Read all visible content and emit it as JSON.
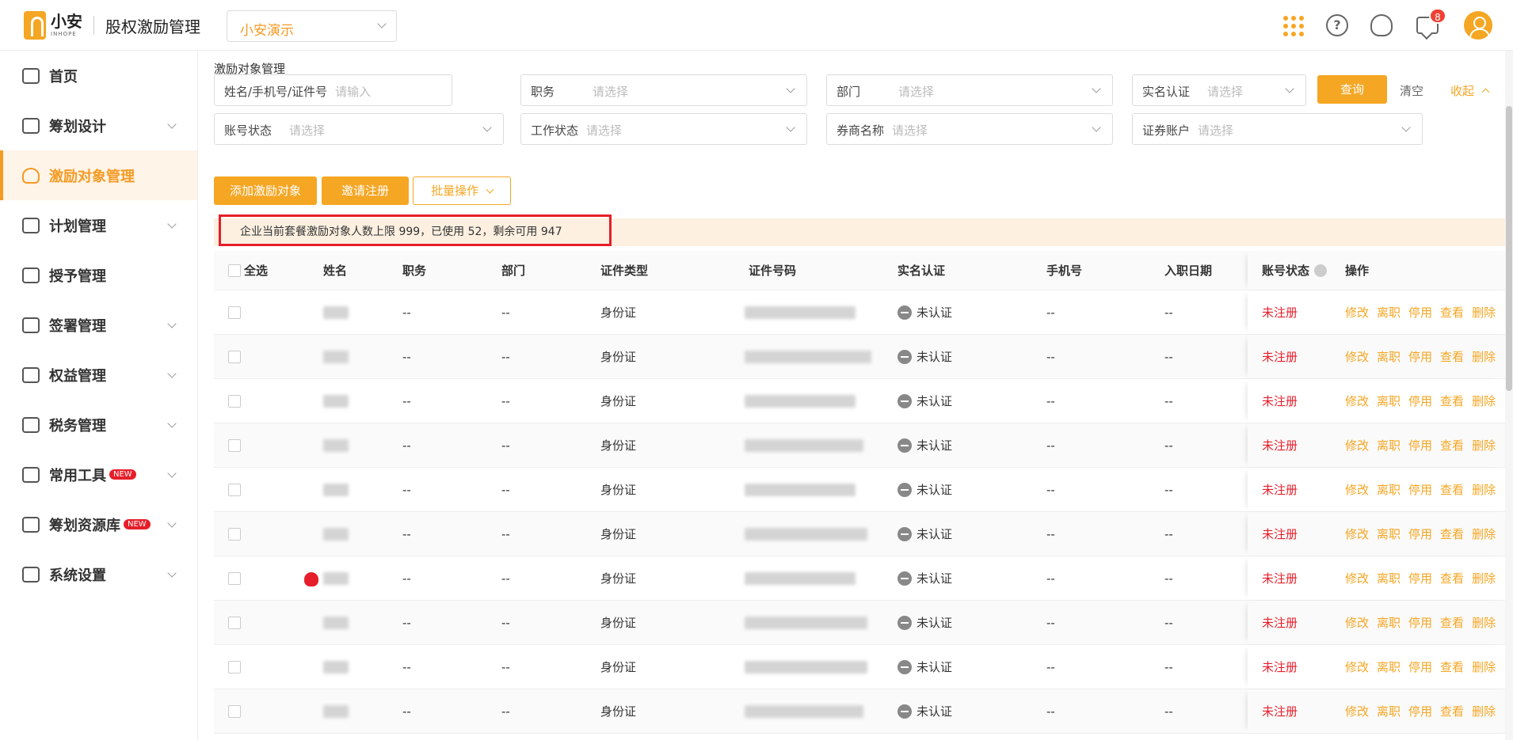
{
  "header": {
    "logo_text": "小安",
    "logo_sub": "INHOPE",
    "app_title": "股权激励管理",
    "company": "小安演示",
    "message_count": "8"
  },
  "sidebar": {
    "items": [
      {
        "label": "首页",
        "icon": "home-icon",
        "chevron": false,
        "new": false
      },
      {
        "label": "筹划设计",
        "icon": "edit-icon",
        "chevron": true,
        "new": false
      },
      {
        "label": "激励对象管理",
        "icon": "users-icon",
        "chevron": false,
        "new": false,
        "active": true
      },
      {
        "label": "计划管理",
        "icon": "grid-plan-icon",
        "chevron": true,
        "new": false
      },
      {
        "label": "授予管理",
        "icon": "book-icon",
        "chevron": false,
        "new": false
      },
      {
        "label": "签署管理",
        "icon": "sign-icon",
        "chevron": true,
        "new": false
      },
      {
        "label": "权益管理",
        "icon": "equity-icon",
        "chevron": true,
        "new": false
      },
      {
        "label": "税务管理",
        "icon": "tax-icon",
        "chevron": true,
        "new": false
      },
      {
        "label": "常用工具",
        "icon": "toolbox-icon",
        "chevron": true,
        "new": true
      },
      {
        "label": "筹划资源库",
        "icon": "layers-icon",
        "chevron": true,
        "new": true
      },
      {
        "label": "系统设置",
        "icon": "settings-icon",
        "chevron": true,
        "new": false
      }
    ],
    "new_label": "NEW"
  },
  "page": {
    "title": "激励对象管理"
  },
  "filters": {
    "name_label": "姓名/手机号/证件号",
    "name_placeholder": "请输入",
    "position_label": "职务",
    "dept_label": "部门",
    "realname_label": "实名认证",
    "account_status_label": "账号状态",
    "work_status_label": "工作状态",
    "broker_label": "券商名称",
    "securities_label": "证券账户",
    "select_placeholder": "请选择",
    "query_btn": "查询",
    "clear_btn": "清空",
    "collapse_link": "收起"
  },
  "actions": {
    "add": "添加激励对象",
    "invite": "邀请注册",
    "batch": "批量操作"
  },
  "notice": "企业当前套餐激励对象人数上限 999，已使用 52，剩余可用 947",
  "table": {
    "headers": {
      "select_all": "全选",
      "name": "姓名",
      "position": "职务",
      "dept": "部门",
      "id_type": "证件类型",
      "id_number": "证件号码",
      "realname": "实名认证",
      "phone": "手机号",
      "join_date": "入职日期",
      "account_status": "账号状态",
      "ops": "操作"
    },
    "rows": [
      {
        "position": "--",
        "dept": "--",
        "id_type": "身份证",
        "realname": "未认证",
        "phone": "--",
        "join_date": "--",
        "status": "未注册",
        "warn": false
      },
      {
        "position": "--",
        "dept": "--",
        "id_type": "身份证",
        "realname": "未认证",
        "phone": "--",
        "join_date": "--",
        "status": "未注册",
        "warn": false
      },
      {
        "position": "--",
        "dept": "--",
        "id_type": "身份证",
        "realname": "未认证",
        "phone": "--",
        "join_date": "--",
        "status": "未注册",
        "warn": false
      },
      {
        "position": "--",
        "dept": "--",
        "id_type": "身份证",
        "realname": "未认证",
        "phone": "--",
        "join_date": "--",
        "status": "未注册",
        "warn": false
      },
      {
        "position": "--",
        "dept": "--",
        "id_type": "身份证",
        "realname": "未认证",
        "phone": "--",
        "join_date": "--",
        "status": "未注册",
        "warn": false
      },
      {
        "position": "--",
        "dept": "--",
        "id_type": "身份证",
        "realname": "未认证",
        "phone": "--",
        "join_date": "--",
        "status": "未注册",
        "warn": false
      },
      {
        "position": "--",
        "dept": "--",
        "id_type": "身份证",
        "realname": "未认证",
        "phone": "--",
        "join_date": "--",
        "status": "未注册",
        "warn": true
      },
      {
        "position": "--",
        "dept": "--",
        "id_type": "身份证",
        "realname": "未认证",
        "phone": "--",
        "join_date": "--",
        "status": "未注册",
        "warn": false
      },
      {
        "position": "--",
        "dept": "--",
        "id_type": "身份证",
        "realname": "未认证",
        "phone": "--",
        "join_date": "--",
        "status": "未注册",
        "warn": false
      },
      {
        "position": "--",
        "dept": "--",
        "id_type": "身份证",
        "realname": "未认证",
        "phone": "--",
        "join_date": "--",
        "status": "未注册",
        "warn": false
      }
    ],
    "ops": [
      "修改",
      "离职",
      "停用",
      "查看",
      "删除"
    ]
  },
  "colors": {
    "accent": "#f5a623",
    "danger": "#e61e2a",
    "notice_bg": "#fdf0e1"
  }
}
